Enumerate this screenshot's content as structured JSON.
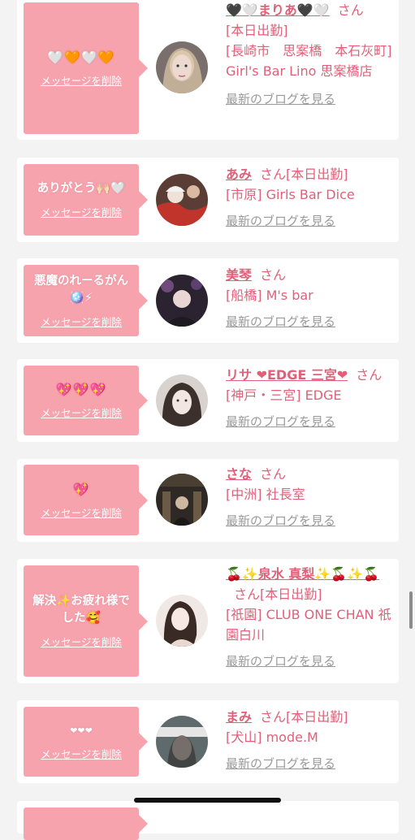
{
  "delete_label": "メッセージを削除",
  "blog_label": "最新のブログを見る",
  "colors": {
    "background": "#f3f3f3",
    "card": "#ffffff",
    "message_box": "#f7a3ae",
    "accent": "#e06079",
    "link_gray": "#9a9a9a"
  },
  "entries": [
    {
      "message": "🤍🧡🤍🧡",
      "name": "🖤🤍まりあ🖤🤍",
      "san": "さん",
      "status": "",
      "shop_line1": "[本日出勤]",
      "shop": "[長崎市　思案橋　本石灰町] Girl's Bar Lino 思案橋店",
      "avatar_icon": "woman-portrait"
    },
    {
      "message": "ありがとう🙌🏻🤍",
      "name": "あみ",
      "san": "さん",
      "status": "[本日出勤]",
      "shop": "[市原] Girls Bar Dice",
      "avatar_icon": "woman-portrait"
    },
    {
      "message": "悪魔のれーるがん🪩⚡",
      "name": "美琴",
      "san": "さん",
      "status": "",
      "shop": "[船橋] M's bar",
      "avatar_icon": "woman-portrait"
    },
    {
      "message": "💖💖💖",
      "name": "リサ ❤EDGE 三宮❤",
      "san": "さん",
      "status": "",
      "shop": "[神戸・三宮] EDGE",
      "avatar_icon": "woman-portrait"
    },
    {
      "message": "💖",
      "name": "さな",
      "san": "さん",
      "status": "",
      "shop": "[中洲] 社長室",
      "avatar_icon": "man-portrait"
    },
    {
      "message": "解決✨お疲れ様でした🥰",
      "name": "🍒✨泉水 真梨✨🍒✨🍒",
      "san": "さん",
      "status": "[本日出勤]",
      "shop": "[祇園] CLUB ONE CHAN 祇園白川",
      "avatar_icon": "woman-portrait"
    },
    {
      "message": "❤❤❤",
      "name": "まみ",
      "san": "さん",
      "status": "[本日出勤]",
      "shop": "[犬山] mode.M",
      "avatar_icon": "woman-portrait"
    }
  ]
}
